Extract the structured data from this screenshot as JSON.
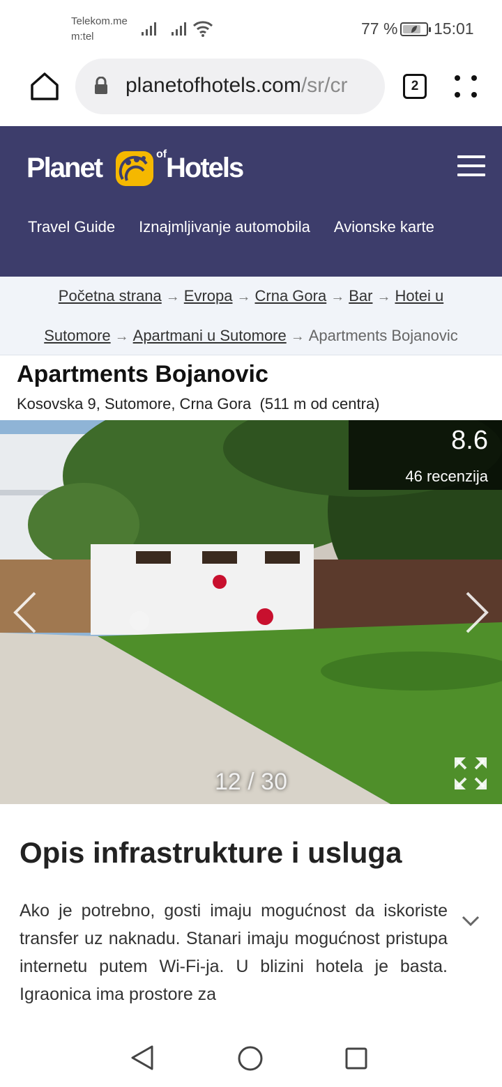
{
  "status_bar": {
    "carrier_line1": "Telekom.me",
    "carrier_line2": "m:tel",
    "battery_percent": "77 %",
    "battery_level": 0.77,
    "time": "15:01",
    "icons": [
      "signal-icon",
      "signal-icon",
      "wifi-icon",
      "battery-icon"
    ]
  },
  "browser": {
    "url_domain": "planetofhotels.com",
    "url_path": "/sr/cr",
    "tab_count": "2",
    "icons": [
      "home-icon",
      "lock-icon",
      "tabs-icon",
      "more-vert-icon"
    ]
  },
  "site_header": {
    "logo_planet": "Planet",
    "logo_of": "of",
    "logo_hotels": "Hotels",
    "nav": [
      "Travel Guide",
      "Iznajmljivanje automobila",
      "Avionske karte"
    ],
    "colors": {
      "header_bg": "#3d3d6b",
      "logo_accent": "#f5b800"
    }
  },
  "breadcrumb": {
    "items": [
      "Početna strana",
      "Evropa",
      "Crna Gora",
      "Bar",
      "Hotei u Sutomore",
      "Apartmani u Sutomore"
    ],
    "item_line1_part": "Hotei u",
    "item_line2_part": "Sutomore",
    "current": "Apartments Bojanovic",
    "separator": "→"
  },
  "hotel": {
    "name": "Apartments Bojanovic",
    "address": "Kosovska 9, Sutomore, Crna Gora",
    "distance": "(511 m od centra)"
  },
  "gallery": {
    "rating": "8.6",
    "reviews": "46 recenzija",
    "counter": "12 / 30",
    "current_index": 12,
    "total": 30
  },
  "description": {
    "title": "Opis infrastrukture i usluga",
    "text": "Ako je potrebno, gosti imaju mogućnost da iskoriste transfer uz naknadu. Stanari imaju mogućnost pristupa internetu putem Wi-Fi-ja. U blizini hotela je basta. Igraonica ima prostore za"
  },
  "android_nav": {
    "icons": [
      "back-icon",
      "home-circle-icon",
      "recent-apps-icon"
    ]
  }
}
